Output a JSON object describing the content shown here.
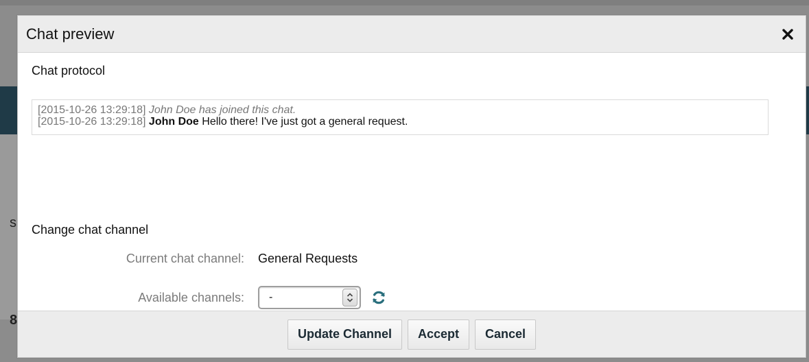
{
  "background": {
    "fragment_1": "s",
    "fragment_2": "8"
  },
  "modal": {
    "title": "Chat preview",
    "close_icon": "close-icon"
  },
  "protocol": {
    "heading": "Chat protocol",
    "messages": [
      {
        "timestamp": "[2015-10-26 13:29:18]",
        "system_text": "John Doe has joined this chat.",
        "author": "",
        "text": ""
      },
      {
        "timestamp": "[2015-10-26 13:29:18]",
        "system_text": "",
        "author": "John Doe",
        "text": "Hello there! I've just got a general request."
      }
    ]
  },
  "channel": {
    "heading": "Change chat channel",
    "current_label": "Current chat channel:",
    "current_value": "General Requests",
    "available_label": "Available channels:",
    "available_selected": "-",
    "refresh_icon": "refresh-icon"
  },
  "footer": {
    "update_label": "Update Channel",
    "accept_label": "Accept",
    "cancel_label": "Cancel"
  },
  "colors": {
    "header_bg": "#ececec",
    "refresh_icon": "#2a6f7d",
    "muted_text": "#777777"
  }
}
